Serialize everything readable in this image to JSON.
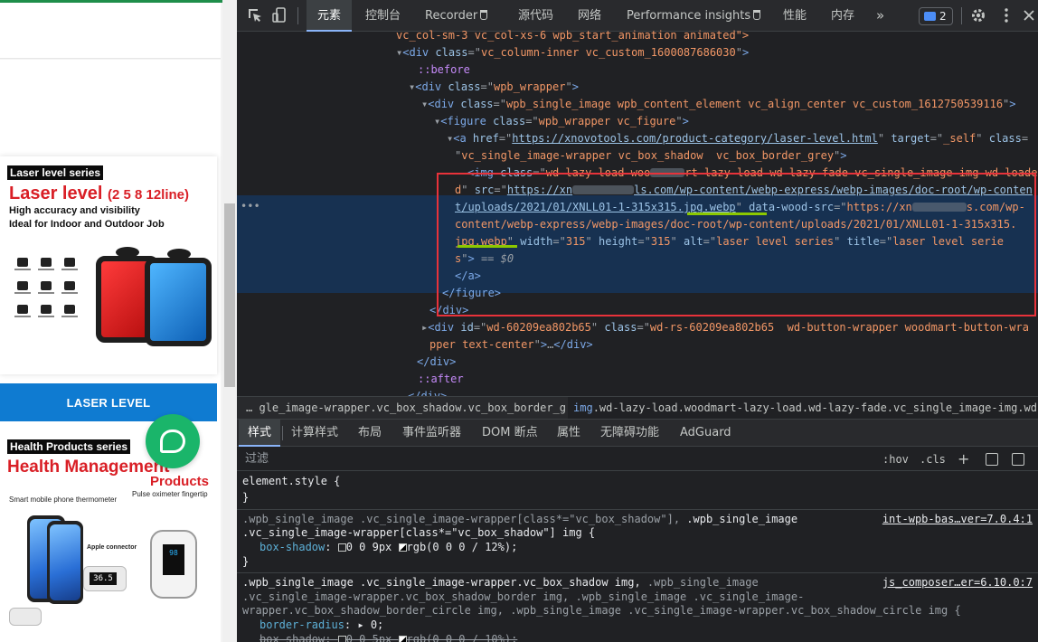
{
  "site": {
    "card1": {
      "series_tag": "Laser level series",
      "title_main": "Laser level ",
      "title_sub": "(2 5 8 12line)",
      "line1": "High accuracy and visibility",
      "line2": "Ideal for Indoor and Outdoor Job"
    },
    "laser_button": "LASER LEVEL",
    "card2": {
      "series_tag": "Health Products series",
      "title": "Health Management",
      "title2": "Products",
      "caption1": "Smart mobile phone thermometer",
      "caption2": "Pulse oximeter fingertip",
      "caption3": "Apple connector",
      "thermo_lcd": "36.5",
      "oxi_lcd": "98"
    }
  },
  "devtools": {
    "tabs": [
      "元素",
      "控制台",
      "Recorder",
      "源代码",
      "网络",
      "Performance insights",
      "性能",
      "内存"
    ],
    "more_tabs": "»",
    "issues_count": "2",
    "elements": {
      "line0": "vc_col-sm-3 vc_col-xs-6 wpb_start_animation animated\">",
      "line1_tag": "div",
      "line1_class": "vc_column-inner vc_custom_1600087686030",
      "line2": "::before",
      "line3_tag": "div",
      "line3_class": "wpb_wrapper",
      "line4_tag": "div",
      "line4_class": "wpb_single_image wpb_content_element vc_align_center vc_custom_1612750539116",
      "line5_tag": "figure",
      "line5_class": "wpb_wrapper vc_figure",
      "line6_href": "https://xnovotools.com/product-category/laser-level.html",
      "line6_target": "_self",
      "line7_class": "vc_single_image-wrapper vc_box_shadow  vc_box_border_grey",
      "img_class_a": "wd-lazy-load woo",
      "img_class_b": "rt-lazy-load wd-lazy-fade vc_single_image-img wd-loade",
      "img_class_c": "d",
      "img_src_a": "https://xn",
      "img_src_b": "ls.com/wp-content/webp-express/webp-images/doc-root/wp-conten",
      "img_src_c": "t/uploads/2021/01/XNLL01-1-315x315.jpg.webp",
      "img_dws_a": "https://xn",
      "img_dws_b": "s.com/wp-",
      "img_dws_c": "content/webp-express/webp-images/doc-root/wp-content/uploads/2021/01/XNLL01-1-315x315.",
      "img_dws_d": "jpg.webp",
      "img_width": "315",
      "img_height": "315",
      "img_alt": "laser level series",
      "img_title_a": "laser level serie",
      "img_title_b": "s",
      "dollar": "$0",
      "close_a": "</a>",
      "close_figure": "</figure>",
      "close_div1": "</div>",
      "line_btn_id": "wd-60209ea802b65",
      "line_btn_class_a": "wd-rs-60209ea802b65  wd-button-wrapper woodmart-button-wra",
      "line_btn_class_b": "pper text-center",
      "after": "::after",
      "close_div2": "</div>",
      "close_div3": "</div>"
    },
    "breadcrumbs": {
      "crumb1": "… gle_image-wrapper.vc_box_shadow.vc_box_border_grey",
      "crumb2_tag": "img",
      "crumb2_rest": ".wd-lazy-load.woodmart-lazy-load.wd-lazy-fade.vc_single_image-img.wd-loaded"
    },
    "subtabs": [
      "样式",
      "计算样式",
      "布局",
      "事件监听器",
      "DOM 断点",
      "属性",
      "无障碍功能",
      "AdGuard"
    ],
    "filter_placeholder": "过滤",
    "hov": ":hov",
    "cls": ".cls",
    "styles": {
      "r1_sel": "element.style {",
      "r1_close": "}",
      "r2_sel_dim": ".wpb_single_image .vc_single_image-wrapper[class*=\"vc_box_shadow\"],",
      "r2_sel_main_a": " .wpb_single_image",
      "r2_sel_main_b": ".vc_single_image-wrapper[class*=\"vc_box_shadow\"] img {",
      "r2_prop": "box-shadow",
      "r2_val": "0 0 9px ",
      "r2_color": "rgb(0 0 0 / 12%)",
      "r2_close": "}",
      "r2_source": "int-wpb-bas…ver=7.0.4:1",
      "r3_sel_main": ".wpb_single_image .vc_single_image-wrapper.vc_box_shadow img,",
      "r3_sel_dim_a": " .wpb_single_image",
      "r3_sel_dim_b": ".vc_single_image-wrapper.vc_box_shadow_border img, .wpb_single_image .vc_single_image-",
      "r3_sel_dim_c": "wrapper.vc_box_shadow_border_circle img, .wpb_single_image .vc_single_image-wrapper.vc_box_shadow_circle img {",
      "r3_prop1": "border-radius",
      "r3_val1": "0;",
      "r3_prop2": "box-shadow",
      "r3_val2": "0 0 5px ",
      "r3_color2": "rgb(0 0 0 / 10%);",
      "r3_source": "js_composer…er=6.10.0:7"
    }
  },
  "colors": {
    "highlight_box": "#e8323a",
    "underline": "#8cc800",
    "selected_row": "#173151",
    "accent_button": "#0f7bd1",
    "chat": "#1ab56a"
  }
}
